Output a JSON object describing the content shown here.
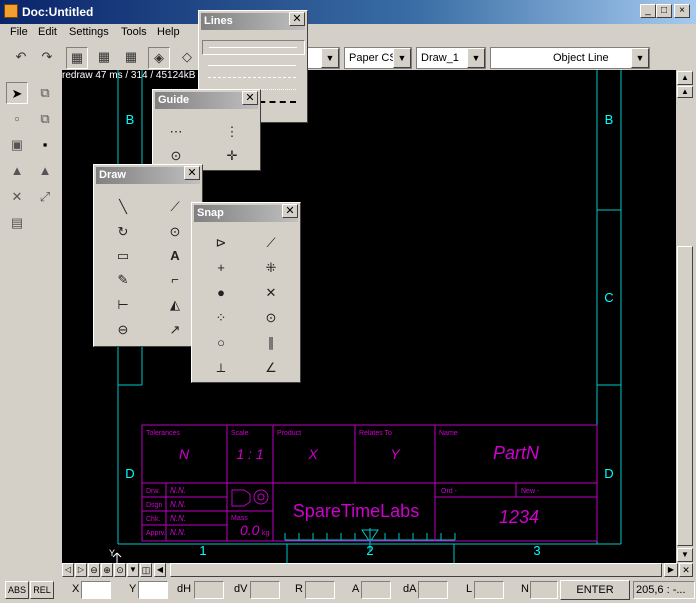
{
  "window": {
    "title": "Doc:Untitled",
    "controls": [
      "_",
      "□",
      "×"
    ]
  },
  "menu": [
    "File",
    "Edit",
    "Settings",
    "Tools",
    "Help"
  ],
  "toolbar": {
    "combos": [
      {
        "value": ""
      },
      {
        "value": "Paper CS"
      },
      {
        "value": "Draw_1"
      },
      {
        "value": "Object Line"
      }
    ]
  },
  "canvas_info": "redraw 47 ms / 314 / 45124kB",
  "drawing": {
    "zone_left": [
      "B",
      "D"
    ],
    "zone_right": [
      "B",
      "C",
      "D"
    ],
    "col_numbers": [
      "1",
      "2",
      "3"
    ],
    "axis_label": "Y",
    "title_block": {
      "tolerances_label": "Tolerances",
      "tolerances": "N",
      "scale_label": "Scale",
      "scale": "1 : 1",
      "product_label": "Product",
      "product": "X",
      "relates_label": "Relates To",
      "relates": "Y",
      "name_label": "Name",
      "name": "PartN",
      "rows": [
        {
          "label": "Drw.",
          "value": "N.N."
        },
        {
          "label": "Dsgn",
          "value": "N.N."
        },
        {
          "label": "Chk.",
          "value": "N.N."
        },
        {
          "label": "Apprv.",
          "value": "N.N."
        }
      ],
      "mass_label": "Mass",
      "mass": "0.0",
      "mass_unit": "kg",
      "company": "SpareTimeLabs",
      "ord_label": "Ord -",
      "new_label": "New -",
      "number": "1234"
    }
  },
  "palettes": {
    "lines": {
      "title": "Lines"
    },
    "guide": {
      "title": "Guide"
    },
    "draw": {
      "title": "Draw"
    },
    "snap": {
      "title": "Snap"
    }
  },
  "status": {
    "abs": "ABS",
    "rel": "REL",
    "labels": [
      "X",
      "Y",
      "dH",
      "dV",
      "R",
      "A",
      "dA",
      "L",
      "N"
    ],
    "enter": "ENTER",
    "coords": "205,6 : -..."
  }
}
